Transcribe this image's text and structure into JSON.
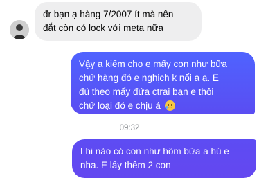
{
  "messages": {
    "incoming_1": {
      "line1": "đr bạn ạ hàng 7/2007 ít mà nên",
      "line2": "đắt còn có lock với meta nữa"
    },
    "outgoing_1": {
      "line1": "Vậy a kiếm cho e mấy con như bữa",
      "line2": "chứ hàng đó e nghịch k nổi a ạ. E",
      "line3": "đú theo mấy đứa ctrai bạn e thôi",
      "line4": "chứ loại đó e chịu á",
      "emoji": "crying-face-icon"
    },
    "timestamp": "09:32",
    "outgoing_2": {
      "line1": "Lhi nào có con như hôm bữa a hú e",
      "line2": "nha. E lấy thêm 2 con"
    }
  },
  "colors": {
    "incoming_bubble": "#eeeeef",
    "outgoing_bubble": "#5560f8",
    "timestamp": "#8a8d91"
  }
}
